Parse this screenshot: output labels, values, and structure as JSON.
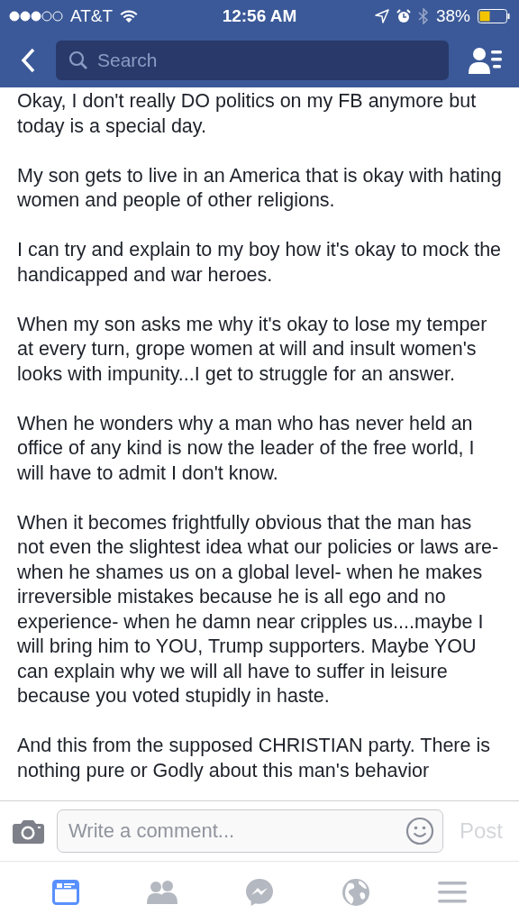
{
  "status_bar": {
    "carrier": "AT&T",
    "time": "12:56 AM",
    "battery": "38%"
  },
  "search": {
    "placeholder": "Search"
  },
  "paragraphs": [
    "Okay, I don't really DO politics on my FB anymore but today is a special day.",
    "My son gets to live in an America that is okay with hating women and people of other religions.",
    "I can try and explain to my boy how it's okay to mock the handicapped and war heroes.",
    "When my son asks me why it's okay to lose my temper at every turn,  grope women at will and insult women's looks with impunity...I get to struggle for an answer.",
    "When he wonders why a man who has never held an office of any kind is now the leader of the free world, I will have to admit I don't know.",
    "When it becomes frightfully obvious that the man has not even the slightest idea what our policies or laws are- when he shames us on a global level- when he makes irreversible mistakes because he is all ego and no experience- when he damn near cripples us....maybe I will bring him to YOU,  Trump supporters. Maybe YOU can explain why we will all have to suffer in leisure because you voted stupidly in haste.",
    "And this from the supposed CHRISTIAN party. There is nothing pure or Godly about this man's behavior"
  ],
  "comment": {
    "placeholder": "Write a comment...",
    "post": "Post"
  },
  "tabs": [
    {
      "kind": "feed",
      "selected": true
    },
    {
      "kind": "friends",
      "selected": false
    },
    {
      "kind": "messenger",
      "selected": false
    },
    {
      "kind": "globe",
      "selected": false
    },
    {
      "kind": "menu",
      "selected": false
    }
  ]
}
